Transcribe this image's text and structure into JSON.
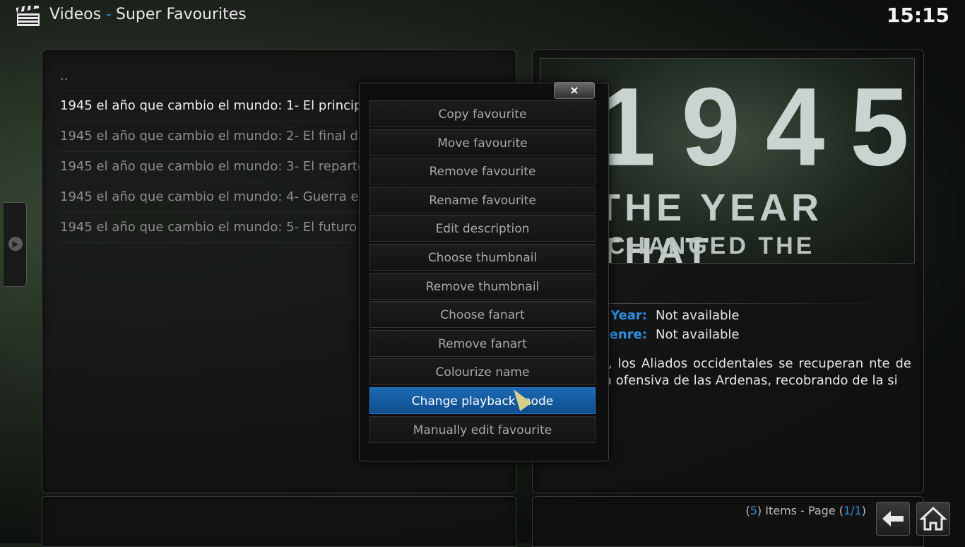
{
  "header": {
    "section": "Videos",
    "separator": "-",
    "subsection": "Super Favourites",
    "clock": "15:15",
    "icon": "clapperboard-icon"
  },
  "list": {
    "parent_label": "..",
    "items": [
      "1945 el año que cambio el mundo: 1- El princip",
      "1945 el año que cambio el mundo: 2- El final d",
      "1945 el año que cambio el mundo: 3- El reparto",
      "1945 el año que cambio el mundo: 4- Guerra e",
      "1945 el año que cambio el mundo: 5- El futuro"
    ]
  },
  "thumbnail": {
    "year": "1945",
    "line1": "THE YEAR THAT",
    "line2": "CHANGED THE WORLD"
  },
  "info": {
    "year_label": "Year:",
    "year_value": "Not available",
    "genre_label": "Genre:",
    "genre_value": "Not available",
    "plot": "o, los Aliados occidentales se recuperan nte de la ofensiva de las Ardenas, recobrando de la si"
  },
  "dialog": {
    "close_label": "×",
    "items": [
      "Copy favourite",
      "Move favourite",
      "Remove favourite",
      "Rename favourite",
      "Edit description",
      "Choose thumbnail",
      "Remove thumbnail",
      "Choose fanart",
      "Remove fanart",
      "Colourize name",
      "Change playback mode",
      "Manually edit favourite"
    ],
    "selected_index": 10
  },
  "footer": {
    "open_paren": "(",
    "count": "5",
    "items_text": ") Items - Page (",
    "page": "1/1",
    "close_paren": ")"
  },
  "colors": {
    "accent": "#2e8fe0",
    "selected": "#1c6ab5"
  }
}
